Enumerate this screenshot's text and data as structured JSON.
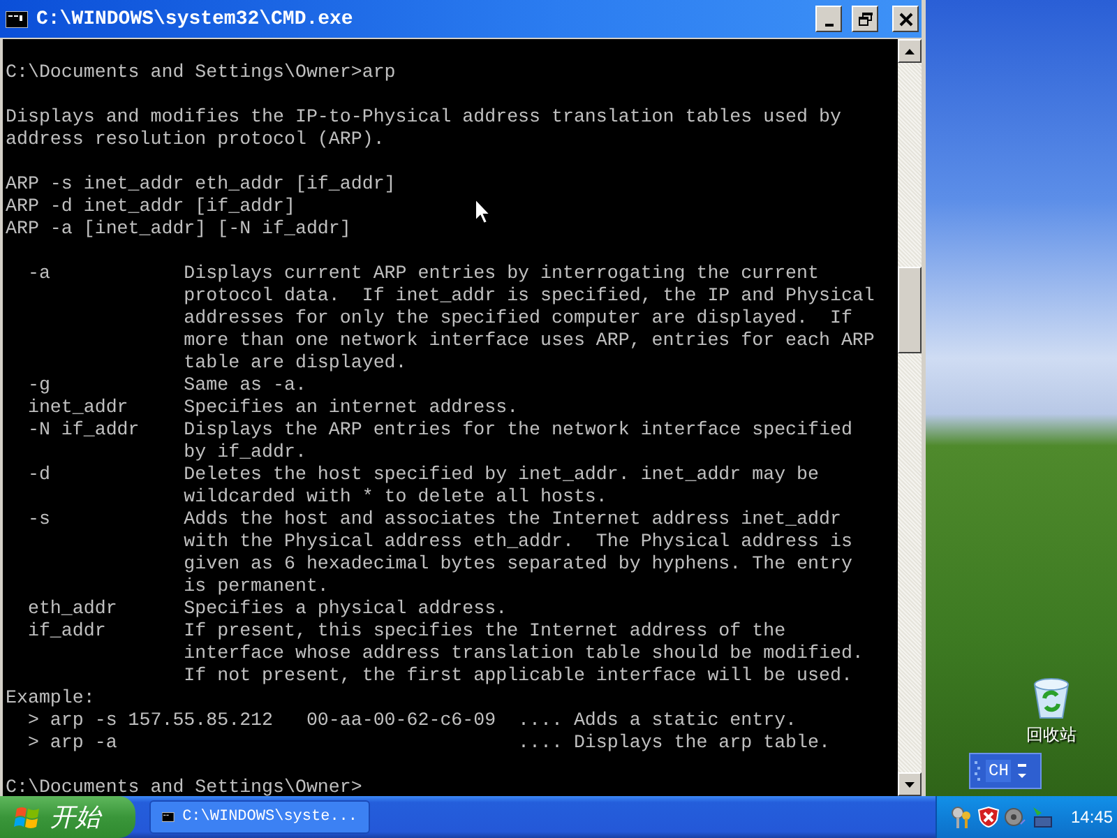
{
  "window": {
    "title": "C:\\WINDOWS\\system32\\CMD.exe"
  },
  "console": {
    "blocks": [
      [
        "C:\\Documents and Settings\\Owner>arp"
      ],
      [
        "Displays and modifies the IP-to-Physical address translation tables used by",
        "address resolution protocol (ARP)."
      ],
      [
        "ARP -s inet_addr eth_addr [if_addr]",
        "ARP -d inet_addr [if_addr]",
        "ARP -a [inet_addr] [-N if_addr]"
      ],
      [
        "  -a            Displays current ARP entries by interrogating the current",
        "                protocol data.  If inet_addr is specified, the IP and Physical",
        "                addresses for only the specified computer are displayed.  If",
        "                more than one network interface uses ARP, entries for each ARP",
        "                table are displayed.",
        "  -g            Same as -a.",
        "  inet_addr     Specifies an internet address.",
        "  -N if_addr    Displays the ARP entries for the network interface specified",
        "                by if_addr.",
        "  -d            Deletes the host specified by inet_addr. inet_addr may be",
        "                wildcarded with * to delete all hosts.",
        "  -s            Adds the host and associates the Internet address inet_addr",
        "                with the Physical address eth_addr.  The Physical address is",
        "                given as 6 hexadecimal bytes separated by hyphens. The entry",
        "                is permanent.",
        "  eth_addr      Specifies a physical address.",
        "  if_addr       If present, this specifies the Internet address of the",
        "                interface whose address translation table should be modified.",
        "                If not present, the first applicable interface will be used.",
        "Example:",
        "  > arp -s 157.55.85.212   00-aa-00-62-c6-09  .... Adds a static entry.",
        "  > arp -a                                    .... Displays the arp table."
      ],
      [
        "C:\\Documents and Settings\\Owner>"
      ]
    ]
  },
  "desktop": {
    "icons": [
      {
        "label": "回收站"
      }
    ]
  },
  "language_bar": {
    "label": "CH"
  },
  "taskbar": {
    "start": "开始",
    "tasks": [
      {
        "label": "C:\\WINDOWS\\syste..."
      }
    ],
    "clock": "14:45"
  }
}
